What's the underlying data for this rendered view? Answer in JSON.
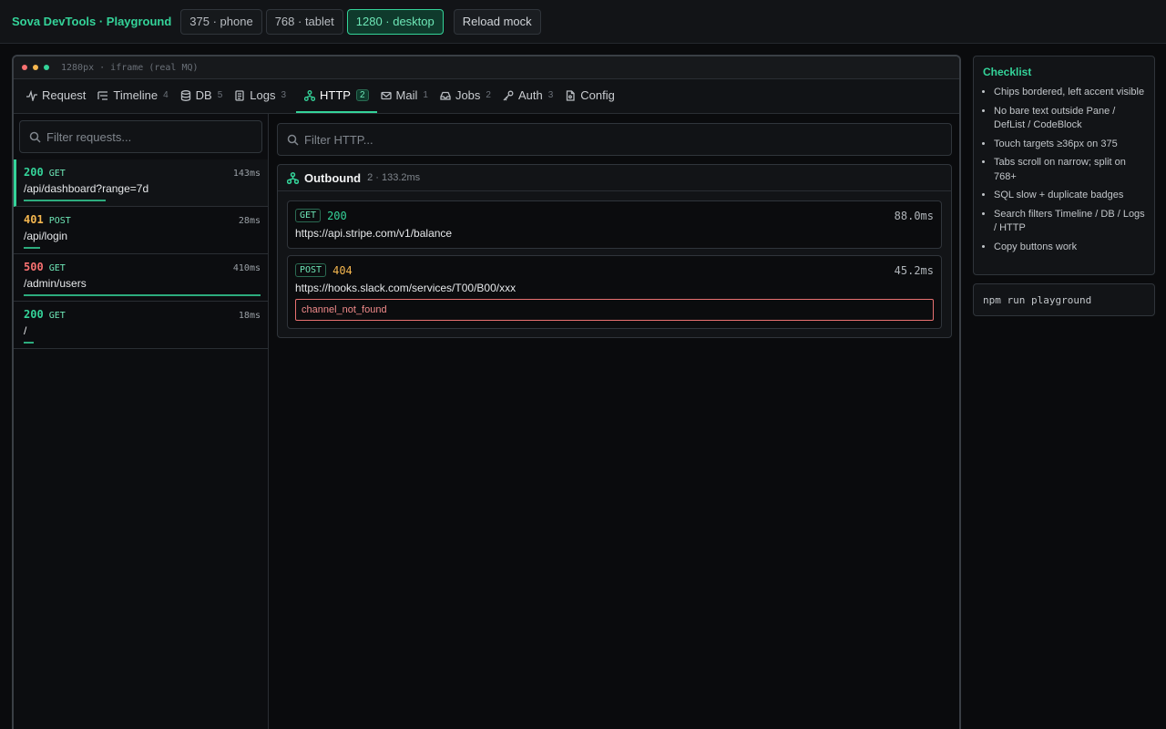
{
  "brand": "Sova DevTools · Playground",
  "viewports": [
    "375 · phone",
    "768 · tablet",
    "1280 · desktop"
  ],
  "reload_label": "Reload mock",
  "frame_label": "1280px · iframe (real MQ)",
  "colors": {
    "accent": "#34d399",
    "ok": "#34d399",
    "warn": "#f5b74f",
    "error": "#f87171"
  },
  "tabs": [
    {
      "label": "Request",
      "icon": "pulse-icon",
      "count": ""
    },
    {
      "label": "Timeline",
      "icon": "timeline-icon",
      "count": "4"
    },
    {
      "label": "DB",
      "icon": "database-icon",
      "count": "5"
    },
    {
      "label": "Logs",
      "icon": "scroll-icon",
      "count": "3"
    },
    {
      "label": "HTTP",
      "icon": "network-icon",
      "count": "2"
    },
    {
      "label": "Mail",
      "icon": "mail-icon",
      "count": "1"
    },
    {
      "label": "Jobs",
      "icon": "inbox-icon",
      "count": "2"
    },
    {
      "label": "Auth",
      "icon": "key-icon",
      "count": "3"
    },
    {
      "label": "Config",
      "icon": "file-icon",
      "count": ""
    }
  ],
  "left_search_placeholder": "Filter requests...",
  "requests": [
    {
      "code": "200",
      "method": "GET",
      "duration": "143ms",
      "path": "/api/dashboard?range=7d"
    },
    {
      "code": "401",
      "method": "POST",
      "duration": "28ms",
      "path": "/api/login"
    },
    {
      "code": "500",
      "method": "GET",
      "duration": "410ms",
      "path": "/admin/users"
    },
    {
      "code": "200",
      "method": "GET",
      "duration": "18ms",
      "path": "/"
    }
  ],
  "http_search_placeholder": "Filter HTTP...",
  "outbound": {
    "title": "Outbound",
    "meta": "2 · 133.2ms",
    "calls": [
      {
        "method": "GET",
        "status": "200",
        "duration": "88.0ms",
        "url": "https://api.stripe.com/v1/balance",
        "error": ""
      },
      {
        "method": "POST",
        "status": "404",
        "duration": "45.2ms",
        "url": "https://hooks.slack.com/services/T00/B00/xxx",
        "error": "channel_not_found"
      }
    ]
  },
  "checklist": {
    "title": "Checklist",
    "items": [
      "Chips bordered, left accent visible",
      "No bare text outside Pane / DefList / CodeBlock",
      "Touch targets ≥36px on 375",
      "Tabs scroll on narrow; split on 768+",
      "SQL slow + duplicate badges",
      "Search filters Timeline / DB / Logs / HTTP",
      "Copy buttons work"
    ]
  },
  "command": "npm run playground"
}
